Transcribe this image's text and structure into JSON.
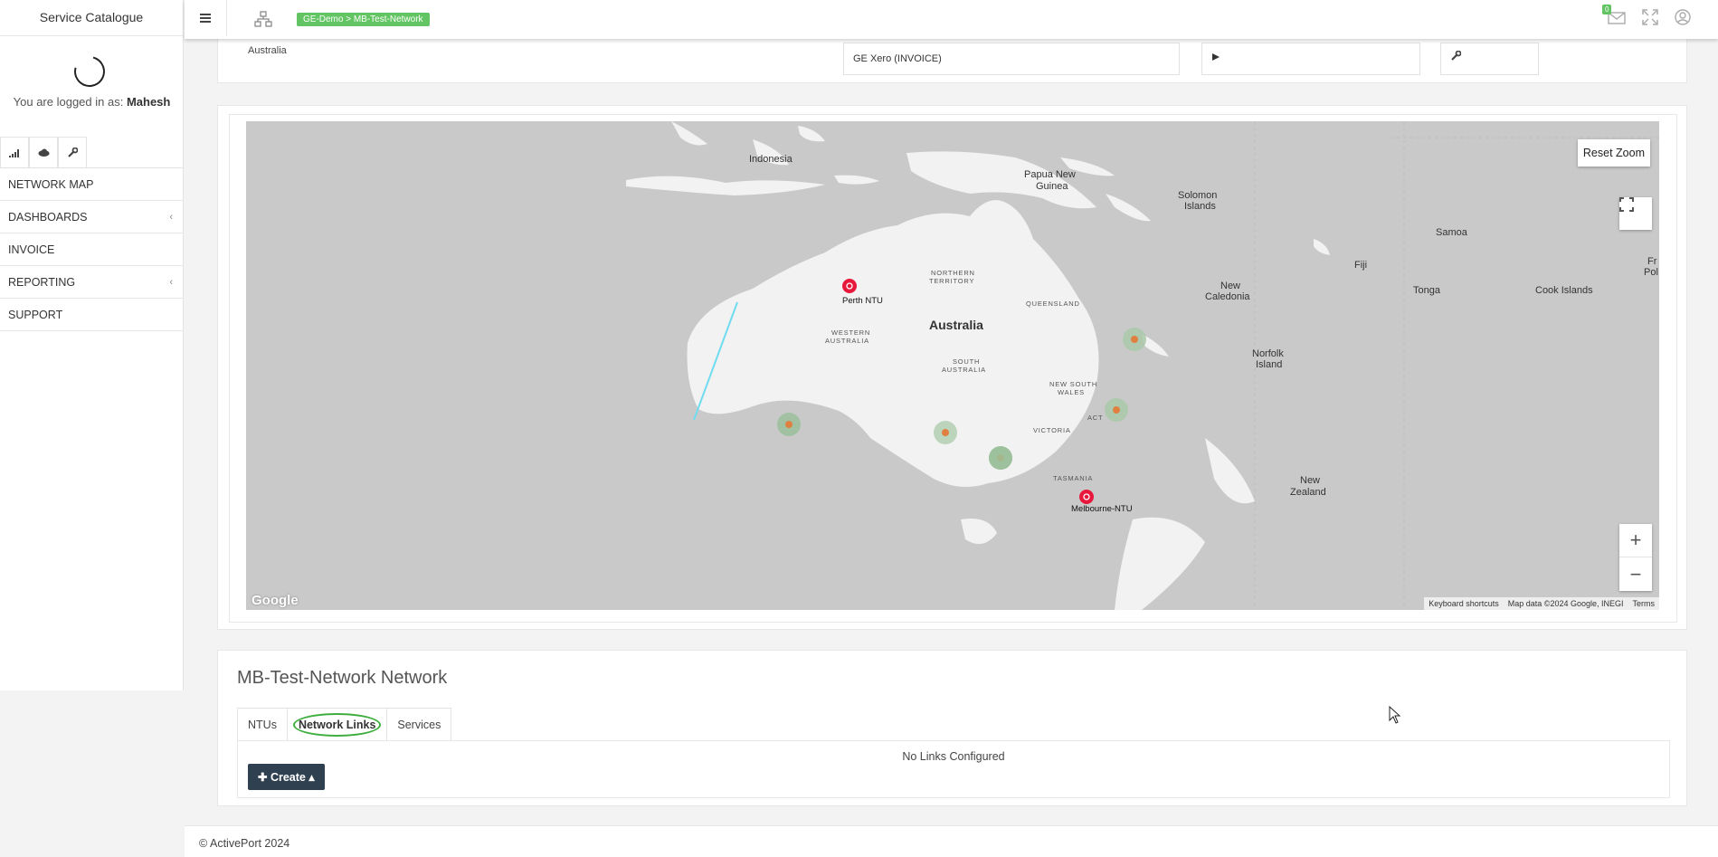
{
  "sidebar": {
    "brand": "Service Catalogue",
    "logged_prefix": "You are logged in as: ",
    "user": "Mahesh",
    "icon_tabs": [
      "signal-icon",
      "cloud-icon",
      "wrench-icon"
    ],
    "nav": [
      {
        "label": "NETWORK MAP",
        "has_children": false
      },
      {
        "label": "DASHBOARDS",
        "has_children": true
      },
      {
        "label": "INVOICE",
        "has_children": false
      },
      {
        "label": "REPORTING",
        "has_children": true
      },
      {
        "label": "SUPPORT",
        "has_children": false
      }
    ]
  },
  "topbar": {
    "breadcrumb": "GE-Demo > MB-Test-Network",
    "mail_count": "0"
  },
  "details": {
    "country": "Australia",
    "billing": "GE Xero (INVOICE)"
  },
  "map": {
    "reset_zoom": "Reset Zoom",
    "zoom_in": "+",
    "zoom_out": "−",
    "provider": "Google",
    "attribution": [
      "Keyboard shortcuts",
      "Map data ©2024 Google, INEGI",
      "Terms"
    ],
    "labels": {
      "indonesia": "Indonesia",
      "png1": "Papua New",
      "png2": "Guinea",
      "sol1": "Solomon",
      "sol2": "Islands",
      "samoa": "Samoa",
      "fiji": "Fiji",
      "fpol1": "Fr",
      "fpol2": "Pol",
      "nt1": "NORTHERN",
      "nt2": "TERRITORY",
      "qld": "QUEENSLAND",
      "australia": "Australia",
      "wa1": "WESTERN",
      "wa2": "AUSTRALIA",
      "sa1": "SOUTH",
      "sa2": "AUSTRALIA",
      "nsw1": "NEW SOUTH",
      "nsw2": "WALES",
      "act": "ACT",
      "vic": "VICTORIA",
      "tas": "TASMANIA",
      "newcal1": "New",
      "newcal2": "Caledonia",
      "tonga": "Tonga",
      "cook": "Cook Islands",
      "norfolk1": "Norfolk",
      "norfolk2": "Island",
      "nz1": "New",
      "nz2": "Zealand"
    },
    "ntus": [
      "Perth NTU",
      "Melbourne-NTU"
    ]
  },
  "network": {
    "title": "MB-Test-Network Network",
    "tabs": [
      "NTUs",
      "Network Links",
      "Services"
    ],
    "active_tab": "Network Links",
    "empty_text": "No Links Configured",
    "create_label": "Create"
  },
  "footer": {
    "text": "© ActivePort 2024"
  },
  "colors": {
    "accent_green": "#62c462",
    "dark_button": "#2f4050",
    "ntu_red": "#e8183d"
  }
}
